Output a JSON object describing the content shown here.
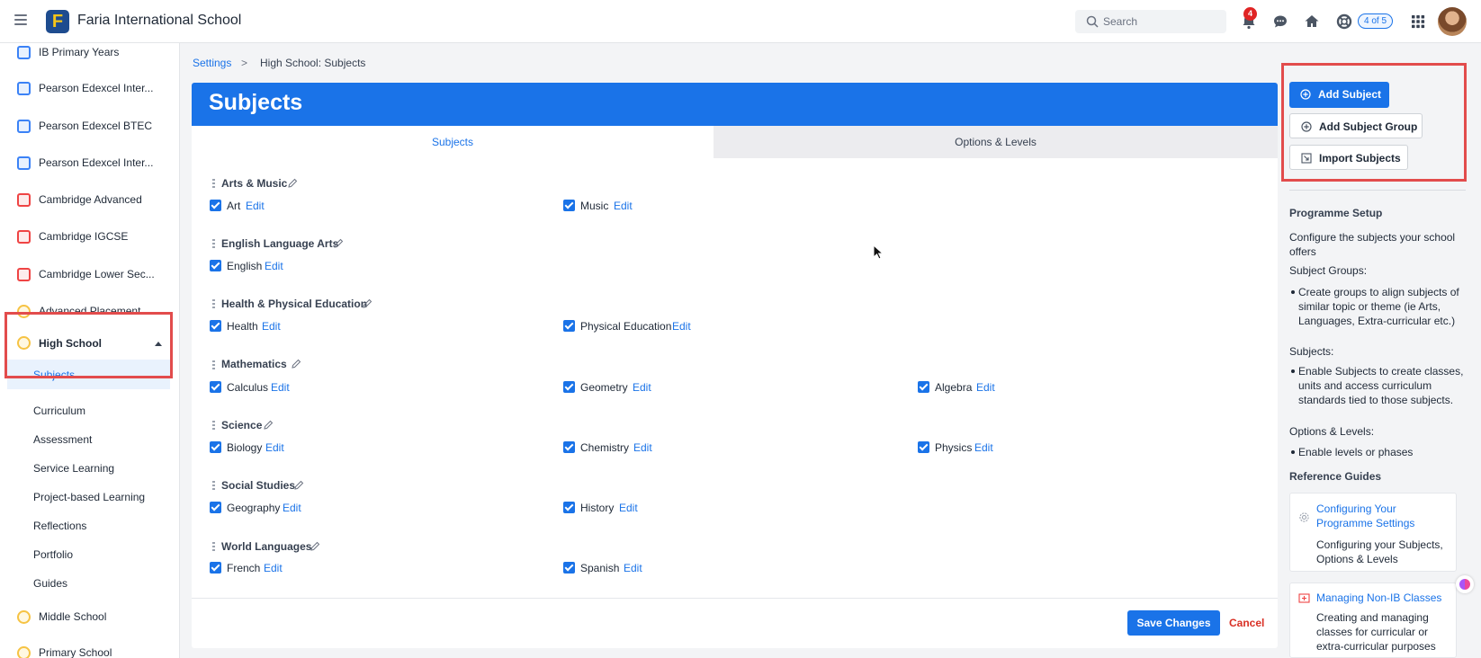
{
  "app": {
    "title": "Faria International School",
    "logo_letter": "F"
  },
  "topbar": {
    "search_placeholder": "Search",
    "notifications_count": "4",
    "progress_pill": "4 of 5",
    "icons": [
      "menu-icon",
      "bell-icon",
      "chat-icon",
      "home-icon",
      "help-lifebuoy-icon",
      "apps-grid-icon",
      "avatar"
    ]
  },
  "sidebar": {
    "items": [
      {
        "label": "IB Primary Years",
        "icon": "blue"
      },
      {
        "label": "Pearson Edexcel Inter...",
        "icon": "blue"
      },
      {
        "label": "Pearson Edexcel BTEC",
        "icon": "blue"
      },
      {
        "label": "Pearson Edexcel Inter...",
        "icon": "blue"
      },
      {
        "label": "Cambridge Advanced",
        "icon": "red"
      },
      {
        "label": "Cambridge IGCSE",
        "icon": "red"
      },
      {
        "label": "Cambridge Lower Sec...",
        "icon": "red"
      },
      {
        "label": "Advanced Placement",
        "icon": "yellow"
      }
    ],
    "expanded": {
      "label": "High School",
      "active_sub": "Subjects"
    },
    "sub_items": [
      "Curriculum",
      "Assessment",
      "Service Learning",
      "Project-based Learning",
      "Reflections",
      "Portfolio",
      "Guides"
    ],
    "after_items": [
      {
        "label": "Middle School",
        "icon": "yellow"
      },
      {
        "label": "Primary School",
        "icon": "yellow"
      }
    ]
  },
  "breadcrumb": {
    "root": "Settings",
    "separator": ">",
    "current": "High School: Subjects"
  },
  "page": {
    "title": "Subjects",
    "tabs": [
      {
        "label": "Subjects",
        "active": true
      },
      {
        "label": "Options & Levels",
        "active": false
      }
    ],
    "edit_label": "Edit",
    "groups": [
      {
        "name": "Arts & Music",
        "subjects": [
          {
            "name": "Art",
            "checked": true
          },
          {
            "name": "Music",
            "checked": true
          }
        ]
      },
      {
        "name": "English Language Arts",
        "subjects": [
          {
            "name": "English",
            "checked": true
          }
        ]
      },
      {
        "name": "Health & Physical Education",
        "subjects": [
          {
            "name": "Health",
            "checked": true
          },
          {
            "name": "Physical Education",
            "checked": true
          }
        ]
      },
      {
        "name": "Mathematics",
        "subjects": [
          {
            "name": "Calculus",
            "checked": true
          },
          {
            "name": "Geometry",
            "checked": true
          },
          {
            "name": "Algebra",
            "checked": true
          }
        ]
      },
      {
        "name": "Science",
        "subjects": [
          {
            "name": "Biology",
            "checked": true
          },
          {
            "name": "Chemistry",
            "checked": true
          },
          {
            "name": "Physics",
            "checked": true
          }
        ]
      },
      {
        "name": "Social Studies",
        "subjects": [
          {
            "name": "Geography",
            "checked": true
          },
          {
            "name": "History",
            "checked": true
          }
        ]
      },
      {
        "name": "World Languages",
        "subjects": [
          {
            "name": "French",
            "checked": true
          },
          {
            "name": "Spanish",
            "checked": true
          }
        ]
      }
    ],
    "save_label": "Save Changes",
    "cancel_label": "Cancel"
  },
  "right_panel": {
    "actions": {
      "add_subject": "Add Subject",
      "add_group": "Add Subject Group",
      "import": "Import Subjects"
    },
    "setup_title": "Programme Setup",
    "setup_intro": "Configure the subjects your school offers",
    "groups_heading": "Subject Groups:",
    "groups_bullet": "Create groups to align subjects of similar topic or theme (ie Arts, Languages, Extra-curricular etc.)",
    "subjects_heading": "Subjects:",
    "subjects_bullet": "Enable Subjects to create classes, units and access curriculum standards tied to those subjects.",
    "options_heading": "Options & Levels:",
    "options_bullet": "Enable levels or phases",
    "guides_title": "Reference Guides",
    "guides": [
      {
        "title": "Configuring Your Programme Settings",
        "desc": "Configuring your Subjects, Options & Levels"
      },
      {
        "title": "Managing Non-IB Classes",
        "desc": "Creating and managing classes for curricular or extra-curricular purposes"
      }
    ]
  },
  "colors": {
    "accent": "#1a73e8",
    "highlight_border": "#e24c4c",
    "danger": "#d93025"
  }
}
